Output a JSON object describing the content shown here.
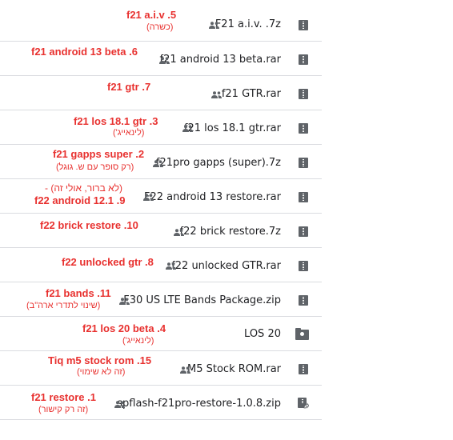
{
  "files": [
    {
      "name": "F21 a.i.v. .7z",
      "note_title": "f21 a.i.v .5",
      "note_sub": "(כשרה)"
    },
    {
      "name": "f21 android 13 beta.rar",
      "note_title": "f21 android 13 beta .6",
      "note_sub": ""
    },
    {
      "name": "f21 GTR.rar",
      "note_title": "f21 gtr .7",
      "note_sub": ""
    },
    {
      "name": "f21 los 18.1 gtr.rar",
      "note_title": "f21 los 18.1 gtr .3",
      "note_sub": "(לינאייג')"
    },
    {
      "name": "f21pro gapps (super).7z",
      "note_title": "f21 gapps super .2",
      "note_sub": "(רק סופר עם ש. גוגל)"
    },
    {
      "name": "F22 android 13 restore.rar",
      "note_title": "(לא ברור, אולי זה) -",
      "note_sub": "f22 android 12.1 .9"
    },
    {
      "name": "f22 brick restore.7z",
      "note_title": "f22 brick restore .10",
      "note_sub": ""
    },
    {
      "name": "f22 unlocked GTR.rar",
      "note_title": "f22 unlocked gtr .8",
      "note_sub": ""
    },
    {
      "name": "F30 US LTE Bands Package.zip",
      "note_title": "f21 bands .11",
      "note_sub": "(שינוי לתדרי ארה\"ב)"
    },
    {
      "name": "LOS 20",
      "note_title": "f21 los 20 beta .4",
      "note_sub": "(לינאייג')"
    },
    {
      "name": "M5 Stock ROM.rar",
      "note_title": "Tiq m5 stock rom .15",
      "note_sub": "(זה לא שימוי)"
    },
    {
      "name": "spflash-f21pro-restore-1.0.8.zip",
      "note_title": "f21 restore .1",
      "note_sub": "(זה רק קישור)"
    }
  ]
}
